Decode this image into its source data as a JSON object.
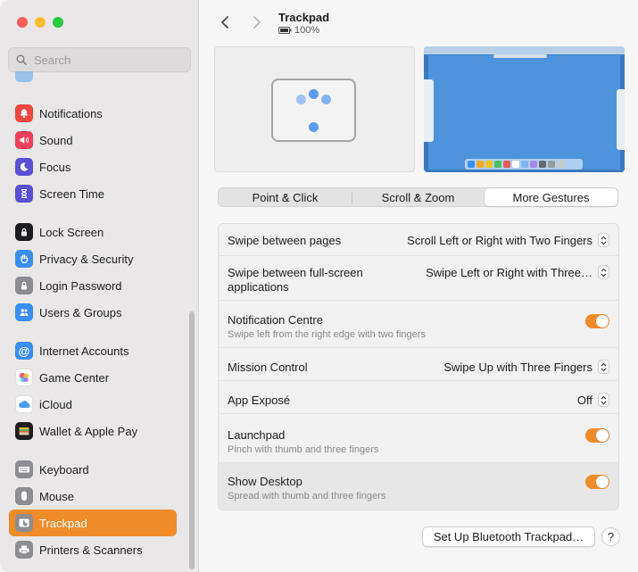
{
  "window": {
    "title": "Trackpad",
    "battery": "100%"
  },
  "search": {
    "placeholder": "Search"
  },
  "sidebar": {
    "items": [
      {
        "label": "Notifications",
        "icon": "bell-icon",
        "color": "#f0483e"
      },
      {
        "label": "Sound",
        "icon": "speaker-icon",
        "color": "#ef3f5a"
      },
      {
        "label": "Focus",
        "icon": "moon-icon",
        "color": "#5b4fd6"
      },
      {
        "label": "Screen Time",
        "icon": "hourglass-icon",
        "color": "#5b4fd6"
      },
      {
        "label": "Lock Screen",
        "icon": "lock-icon",
        "color": "#1d1d1f"
      },
      {
        "label": "Privacy & Security",
        "icon": "hand-icon",
        "color": "#3a8ef6"
      },
      {
        "label": "Login Password",
        "icon": "lock-icon",
        "color": "#8d8d92"
      },
      {
        "label": "Users & Groups",
        "icon": "users-icon",
        "color": "#3a8ef6"
      },
      {
        "label": "Internet Accounts",
        "icon": "at-icon",
        "color": "#3a8ef6"
      },
      {
        "label": "Game Center",
        "icon": "game-center-icon",
        "color": "#ffffff"
      },
      {
        "label": "iCloud",
        "icon": "cloud-icon",
        "color": "#ffffff"
      },
      {
        "label": "Wallet & Apple Pay",
        "icon": "wallet-icon",
        "color": "#1d1d1f"
      },
      {
        "label": "Keyboard",
        "icon": "keyboard-icon",
        "color": "#8d8d92"
      },
      {
        "label": "Mouse",
        "icon": "mouse-icon",
        "color": "#8d8d92"
      },
      {
        "label": "Trackpad",
        "icon": "trackpad-icon",
        "color": "#8d8d92",
        "active": true
      },
      {
        "label": "Printers & Scanners",
        "icon": "printer-icon",
        "color": "#8d8d92"
      }
    ]
  },
  "tabs": [
    {
      "label": "Point & Click",
      "selected": false
    },
    {
      "label": "Scroll & Zoom",
      "selected": false
    },
    {
      "label": "More Gestures",
      "selected": true
    }
  ],
  "settings": [
    {
      "label": "Swipe between pages",
      "value": "Scroll Left or Right with Two Fingers",
      "control": "popup"
    },
    {
      "label": "Swipe between full-screen applications",
      "value": "Swipe Left or Right with Three…",
      "control": "popup"
    },
    {
      "label": "Notification Centre",
      "sub": "Swipe left from the right edge with two fingers",
      "control": "toggle",
      "on": true
    },
    {
      "label": "Mission Control",
      "value": "Swipe Up with Three Fingers",
      "control": "popup"
    },
    {
      "label": "App Exposé",
      "value": "Off",
      "control": "popup"
    },
    {
      "label": "Launchpad",
      "sub": "Pinch with thumb and three fingers",
      "control": "toggle",
      "on": true
    },
    {
      "label": "Show Desktop",
      "sub": "Spread with thumb and three fingers",
      "control": "toggle",
      "on": true
    }
  ],
  "buttons": {
    "setup_bluetooth": "Set Up Bluetooth Trackpad…",
    "help": "?"
  },
  "colors": {
    "accent": "#f08b29",
    "sidebar_bg": "#e9e7e8"
  }
}
